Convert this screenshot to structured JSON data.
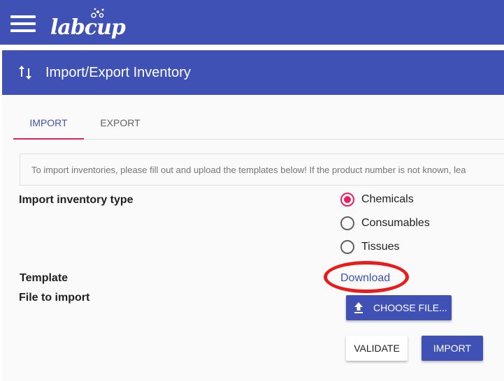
{
  "app": {
    "logo_text": "labcup"
  },
  "header": {
    "title": "Import/Export Inventory",
    "icon": "swap-vertical-icon"
  },
  "tabs": [
    {
      "label": "IMPORT",
      "active": true
    },
    {
      "label": "EXPORT",
      "active": false
    }
  ],
  "info": {
    "text": "To import inventories, please fill out and upload the templates below! If the product number is not known, lea"
  },
  "form": {
    "type_label": "Import inventory type",
    "options": [
      {
        "label": "Chemicals",
        "checked": true
      },
      {
        "label": "Consumables",
        "checked": false
      },
      {
        "label": "Tissues",
        "checked": false
      }
    ],
    "template_label": "Template",
    "download_label": "Download",
    "file_label": "File to import",
    "choose_file_label": "CHOOSE FILE...",
    "validate_label": "VALIDATE",
    "import_label": "IMPORT"
  },
  "colors": {
    "primary": "#3f51b5",
    "accent": "#e91e63",
    "highlight": "#e81c1c"
  }
}
